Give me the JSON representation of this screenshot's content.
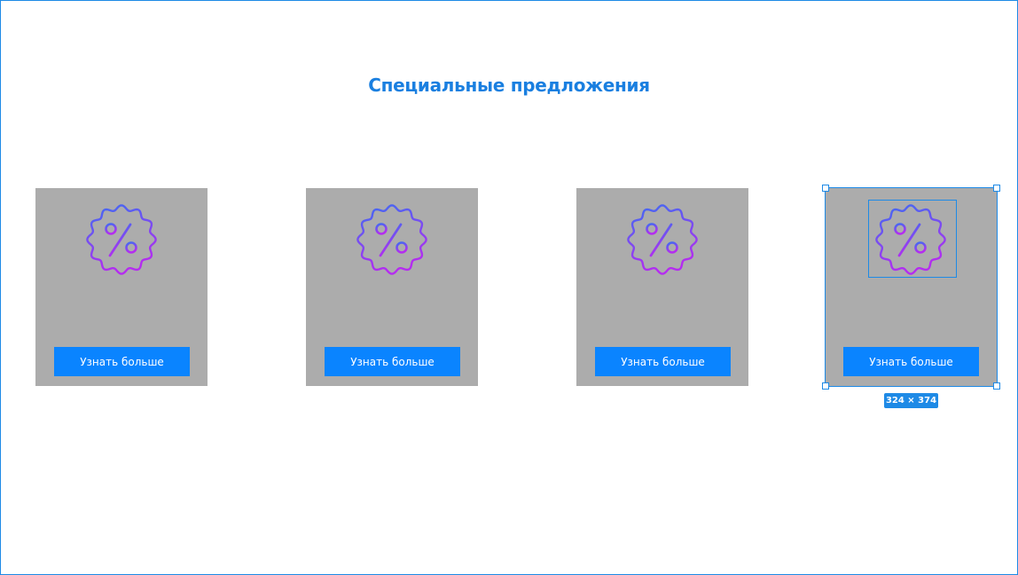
{
  "page": {
    "title": "Специальные предложения"
  },
  "colors": {
    "accent": "#1a7fe0",
    "button": "#0a84ff",
    "card": "#acacac",
    "icon_gradient_start": "#3d6cf2",
    "icon_gradient_end": "#b52cf0"
  },
  "cards": [
    {
      "icon": "discount-badge-icon",
      "button_label": "Узнать больше"
    },
    {
      "icon": "discount-badge-icon",
      "button_label": "Узнать больше"
    },
    {
      "icon": "discount-badge-icon",
      "button_label": "Узнать больше"
    },
    {
      "icon": "discount-badge-icon",
      "button_label": "Узнать больше"
    }
  ],
  "selection": {
    "size_label": "324 × 374"
  }
}
